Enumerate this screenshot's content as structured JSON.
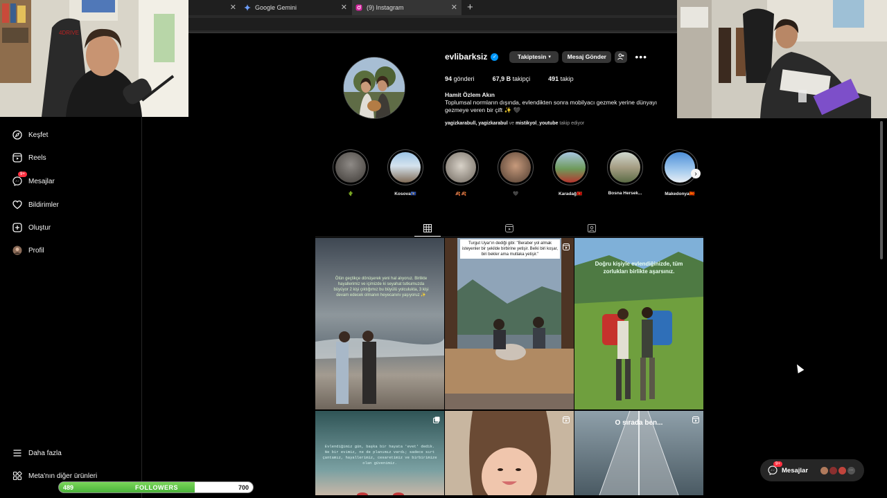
{
  "browser": {
    "tabs": [
      {
        "label": "",
        "active": false
      },
      {
        "label": "Google Gemini",
        "active": false
      },
      {
        "label": "(9) Instagram",
        "active": true
      }
    ]
  },
  "nav": {
    "items": [
      {
        "label": "Keşfet",
        "icon": "compass-icon"
      },
      {
        "label": "Reels",
        "icon": "reels-icon"
      },
      {
        "label": "Mesajlar",
        "icon": "messenger-icon",
        "badge": "9+"
      },
      {
        "label": "Bildirimler",
        "icon": "heart-icon"
      },
      {
        "label": "Oluştur",
        "icon": "plus-square-icon"
      },
      {
        "label": "Profil",
        "icon": "profile-avatar"
      }
    ],
    "more": "Daha fazla",
    "meta": "Meta'nın diğer ürünleri"
  },
  "profile": {
    "username": "evlibarksiz",
    "following_button": "Takiptesin",
    "message_button": "Mesaj Gönder",
    "stats": {
      "posts": "94",
      "posts_label": "gönderi",
      "followers": "67,9 B",
      "followers_label": "takipçi",
      "following": "491",
      "following_label": "takip"
    },
    "bio_name": "Hamit Özlem Akın",
    "bio": "Toplumsal normların dışında, evlendikten sonra mobilyacı gezmek yerine dünyayı gezmeye veren bir çift ✨ 🖤",
    "followed_by_names": "yagizkarabull, yagizkarabul",
    "followed_by_and": "ve",
    "followed_by_last": "mistikyol_youtube",
    "followed_by_suffix": "takip ediyor"
  },
  "highlights": [
    {
      "label": "🌵"
    },
    {
      "label": "Kosova🇽🇰"
    },
    {
      "label": "🍂🍂"
    },
    {
      "label": "🖤"
    },
    {
      "label": "Karadağ🇲🇪"
    },
    {
      "label": "Bosna Hersek..."
    },
    {
      "label": "Makedonya🇲🇰"
    }
  ],
  "posts": [
    {
      "caption": "Ölün geçtikçe dönüşerek yeni hal alıyoruz. Birlikte hayallerimiz ve içimizde ki seyahat tutkumuzda büyüyor 2 kişi çıktığımız bu büyülü yolculukta, 3 kişi devam edecek olmanın heyecanını yaşıyoruz ✨"
    },
    {
      "caption": "Turgut Uyar'ın dediği gibi: \"Beraber yol almak isteyenler bir şekilde birbirine yetişir. Belki biri koşar, biri bekler ama mutlaka yetişir.\""
    },
    {
      "caption": "Doğru kişiyle evlendiğinizde, tüm zorlukları birlikte aşarsınız."
    },
    {
      "caption": "Evlendiğimiz gün, başka bir hayata 'evet' dedik. Ne bir evimiz, ne de planımız vardı; sadece sırt çantamız, hayallerimiz, cesaretimiz ve birbirimize olan güvenimiz."
    },
    {
      "caption": ""
    },
    {
      "caption": "O sırada ben..."
    }
  ],
  "messages_pill": {
    "label": "Mesajlar",
    "badge": "9+"
  },
  "followers_goal": {
    "current": "489",
    "label": "FOLLOWERS",
    "goal": "700",
    "progress": 0.699
  }
}
